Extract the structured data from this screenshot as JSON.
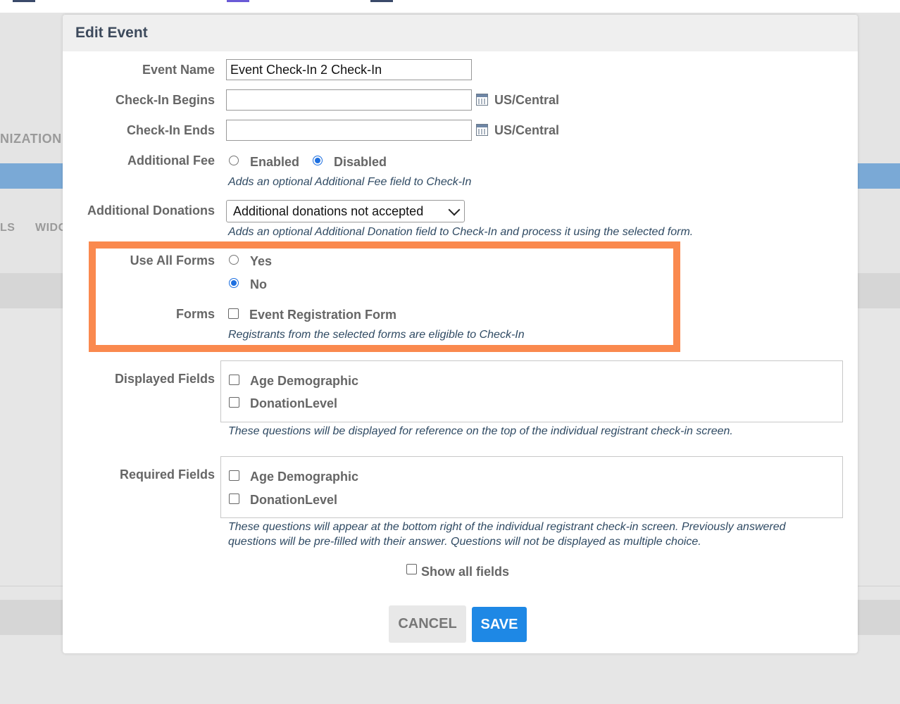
{
  "background": {
    "left_text_1": "NIZATION",
    "left_text_2": "LS",
    "left_text_3": "WIDG"
  },
  "modal": {
    "title": "Edit Event",
    "event_name": {
      "label": "Event Name",
      "value": "Event Check-In 2 Check-In"
    },
    "checkin_begins": {
      "label": "Check-In Begins",
      "value": "",
      "timezone": "US/Central",
      "icon": "calendar-icon"
    },
    "checkin_ends": {
      "label": "Check-In Ends",
      "value": "",
      "timezone": "US/Central",
      "icon": "calendar-icon"
    },
    "additional_fee": {
      "label": "Additional Fee",
      "options": [
        {
          "label": "Enabled",
          "selected": false
        },
        {
          "label": "Disabled",
          "selected": true
        }
      ],
      "hint": "Adds an optional Additional Fee field to Check-In"
    },
    "additional_donations": {
      "label": "Additional Donations",
      "selected": "Additional donations not accepted",
      "hint": "Adds an optional Additional Donation field to Check-In and process it using the selected form."
    },
    "use_all_forms": {
      "label": "Use All Forms",
      "options": [
        {
          "label": "Yes",
          "selected": false
        },
        {
          "label": "No",
          "selected": true
        }
      ]
    },
    "forms": {
      "label": "Forms",
      "items": [
        {
          "label": "Event Registration Form",
          "checked": false
        }
      ],
      "hint": "Registrants from the selected forms are eligible to Check-In"
    },
    "displayed_fields": {
      "label": "Displayed Fields",
      "items": [
        {
          "label": "Age Demographic",
          "checked": false
        },
        {
          "label": "DonationLevel",
          "checked": false
        }
      ],
      "hint": "These questions will be displayed for reference on the top of the individual registrant check-in screen."
    },
    "required_fields": {
      "label": "Required Fields",
      "items": [
        {
          "label": "Age Demographic",
          "checked": false
        },
        {
          "label": "DonationLevel",
          "checked": false
        }
      ],
      "hint_line1": "These questions will appear at the bottom right of the individual registrant check-in screen. Previously answered",
      "hint_line2": "questions will be pre-filled with their answer. Questions will not be displayed as multiple choice."
    },
    "show_all_fields": {
      "label": "Show all fields",
      "checked": false
    },
    "buttons": {
      "cancel": "CANCEL",
      "save": "SAVE"
    }
  },
  "colors": {
    "highlight": "#fa894e",
    "save": "#1e88e5",
    "radio_selected": "#1d6fe0"
  }
}
